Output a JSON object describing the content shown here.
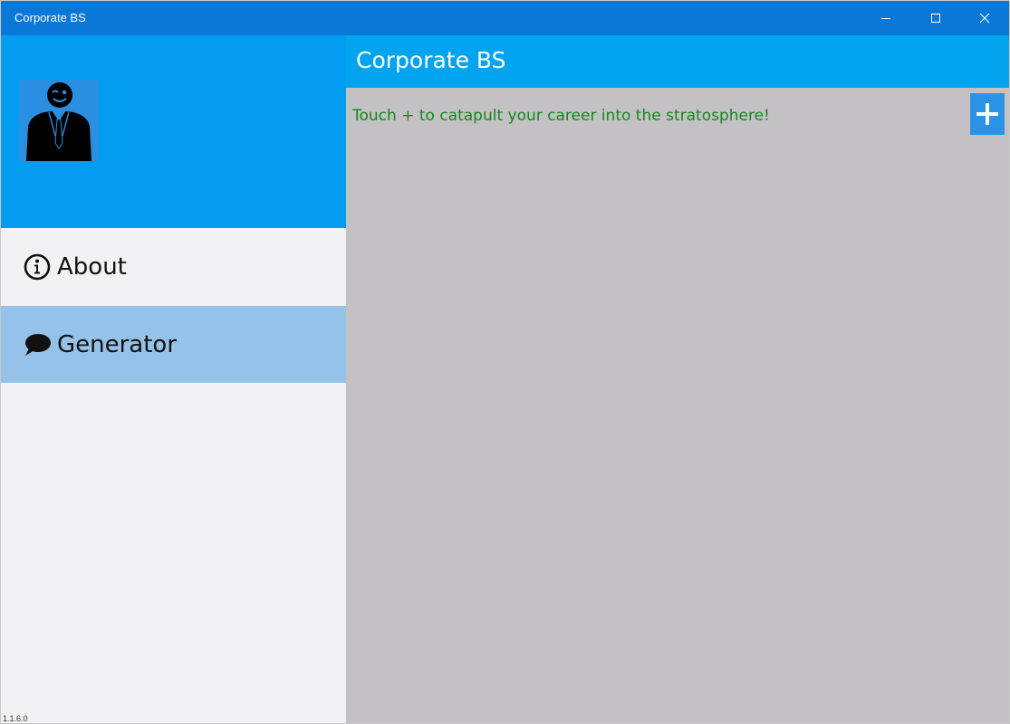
{
  "window": {
    "title": "Corporate BS",
    "controls": {
      "minimize_icon": "minimize-icon",
      "maximize_icon": "maximize-icon",
      "close_icon": "close-icon"
    }
  },
  "sidebar": {
    "avatar_icon": "businessman-avatar-icon",
    "items": [
      {
        "label": "About",
        "icon": "info-icon",
        "selected": false
      },
      {
        "label": "Generator",
        "icon": "speech-bubble-icon",
        "selected": true
      }
    ],
    "version": "1.1.6.0"
  },
  "header": {
    "title": "Corporate BS"
  },
  "main": {
    "prompt": "Touch + to catapult your career into the stratosphere!",
    "add_button_icon": "plus-icon"
  },
  "colors": {
    "titlebar": "#0a78d7",
    "sidebar_header": "#039cf0",
    "app_header": "#03a4ef",
    "selected_item": "#94c2e8",
    "content_bg": "#c4c1c4",
    "prompt_text": "#12891a",
    "add_button": "#2b93e6"
  }
}
